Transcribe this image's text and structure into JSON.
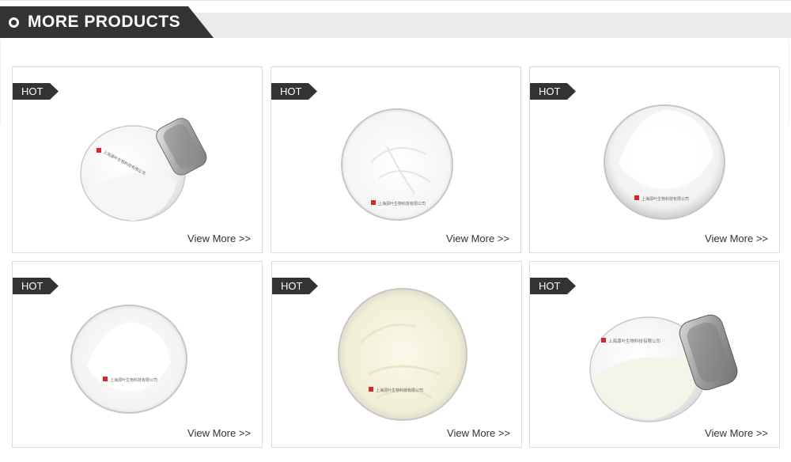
{
  "header": {
    "title": "MORE PRODUCTS"
  },
  "products": [
    {
      "badge": "HOT",
      "link": "View More >>",
      "image": "jar-powder-image"
    },
    {
      "badge": "HOT",
      "link": "View More >>",
      "image": "dish-powder-image"
    },
    {
      "badge": "HOT",
      "link": "View More >>",
      "image": "dish-powder-image"
    },
    {
      "badge": "HOT",
      "link": "View More >>",
      "image": "dish-powder-image"
    },
    {
      "badge": "HOT",
      "link": "View More >>",
      "image": "dish-powder-image"
    },
    {
      "badge": "HOT",
      "link": "View More >>",
      "image": "jar-powder-image"
    }
  ],
  "brand_label": "上海源叶生物科技有限公司",
  "colors": {
    "accent": "#333333",
    "band": "#ebebeb",
    "border": "#dcdcdc",
    "logo": "#d9262b",
    "powder_cream": "#f4f1dc"
  }
}
